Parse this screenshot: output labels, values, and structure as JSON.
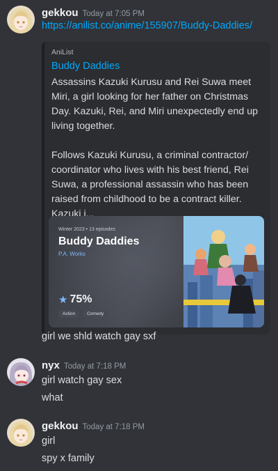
{
  "messages": [
    {
      "user": "gekkou",
      "time": "Today at 7:05 PM",
      "link": "https://anilist.co/anime/155907/Buddy-Daddies/",
      "embed": {
        "provider": "AniList",
        "title": "Buddy Daddies",
        "description_1": "Assassins Kazuki Kurusu and Rei Suwa meet Miri, a girl looking for her father on Christmas Day. Kazuki, Rei, and Miri unexpectedly end up living together.",
        "description_2": "Follows Kazuki Kurusu, a criminal contractor/ coordinator who lives with his best friend, Rei Suwa, a professional assassin who has been raised from childhood to be a contract killer. Kazuki i...",
        "card": {
          "season": "Winter 2023 • 13 episodes",
          "title": "Buddy Daddies",
          "studio": "P.A. Works",
          "score": "75%",
          "tags": [
            "Action",
            "Comedy"
          ]
        }
      },
      "lines": [
        "girl we shld watch gay sxf"
      ]
    },
    {
      "user": "nyx",
      "time": "Today at 7:18 PM",
      "lines": [
        "girl watch gay sex",
        "what"
      ]
    },
    {
      "user": "gekkou",
      "time": "Today at 7:18 PM",
      "lines": [
        "girl",
        "spy x family"
      ]
    }
  ],
  "icons": {
    "score": "star-icon",
    "avatar_gekkou": "anime-girl-avatar",
    "avatar_nyx": "anime-girl-avatar"
  },
  "colors": {
    "background": "#313338",
    "link": "#00a8fc",
    "embed_bg": "#2b2d31",
    "score_star": "#7eb8ff"
  }
}
